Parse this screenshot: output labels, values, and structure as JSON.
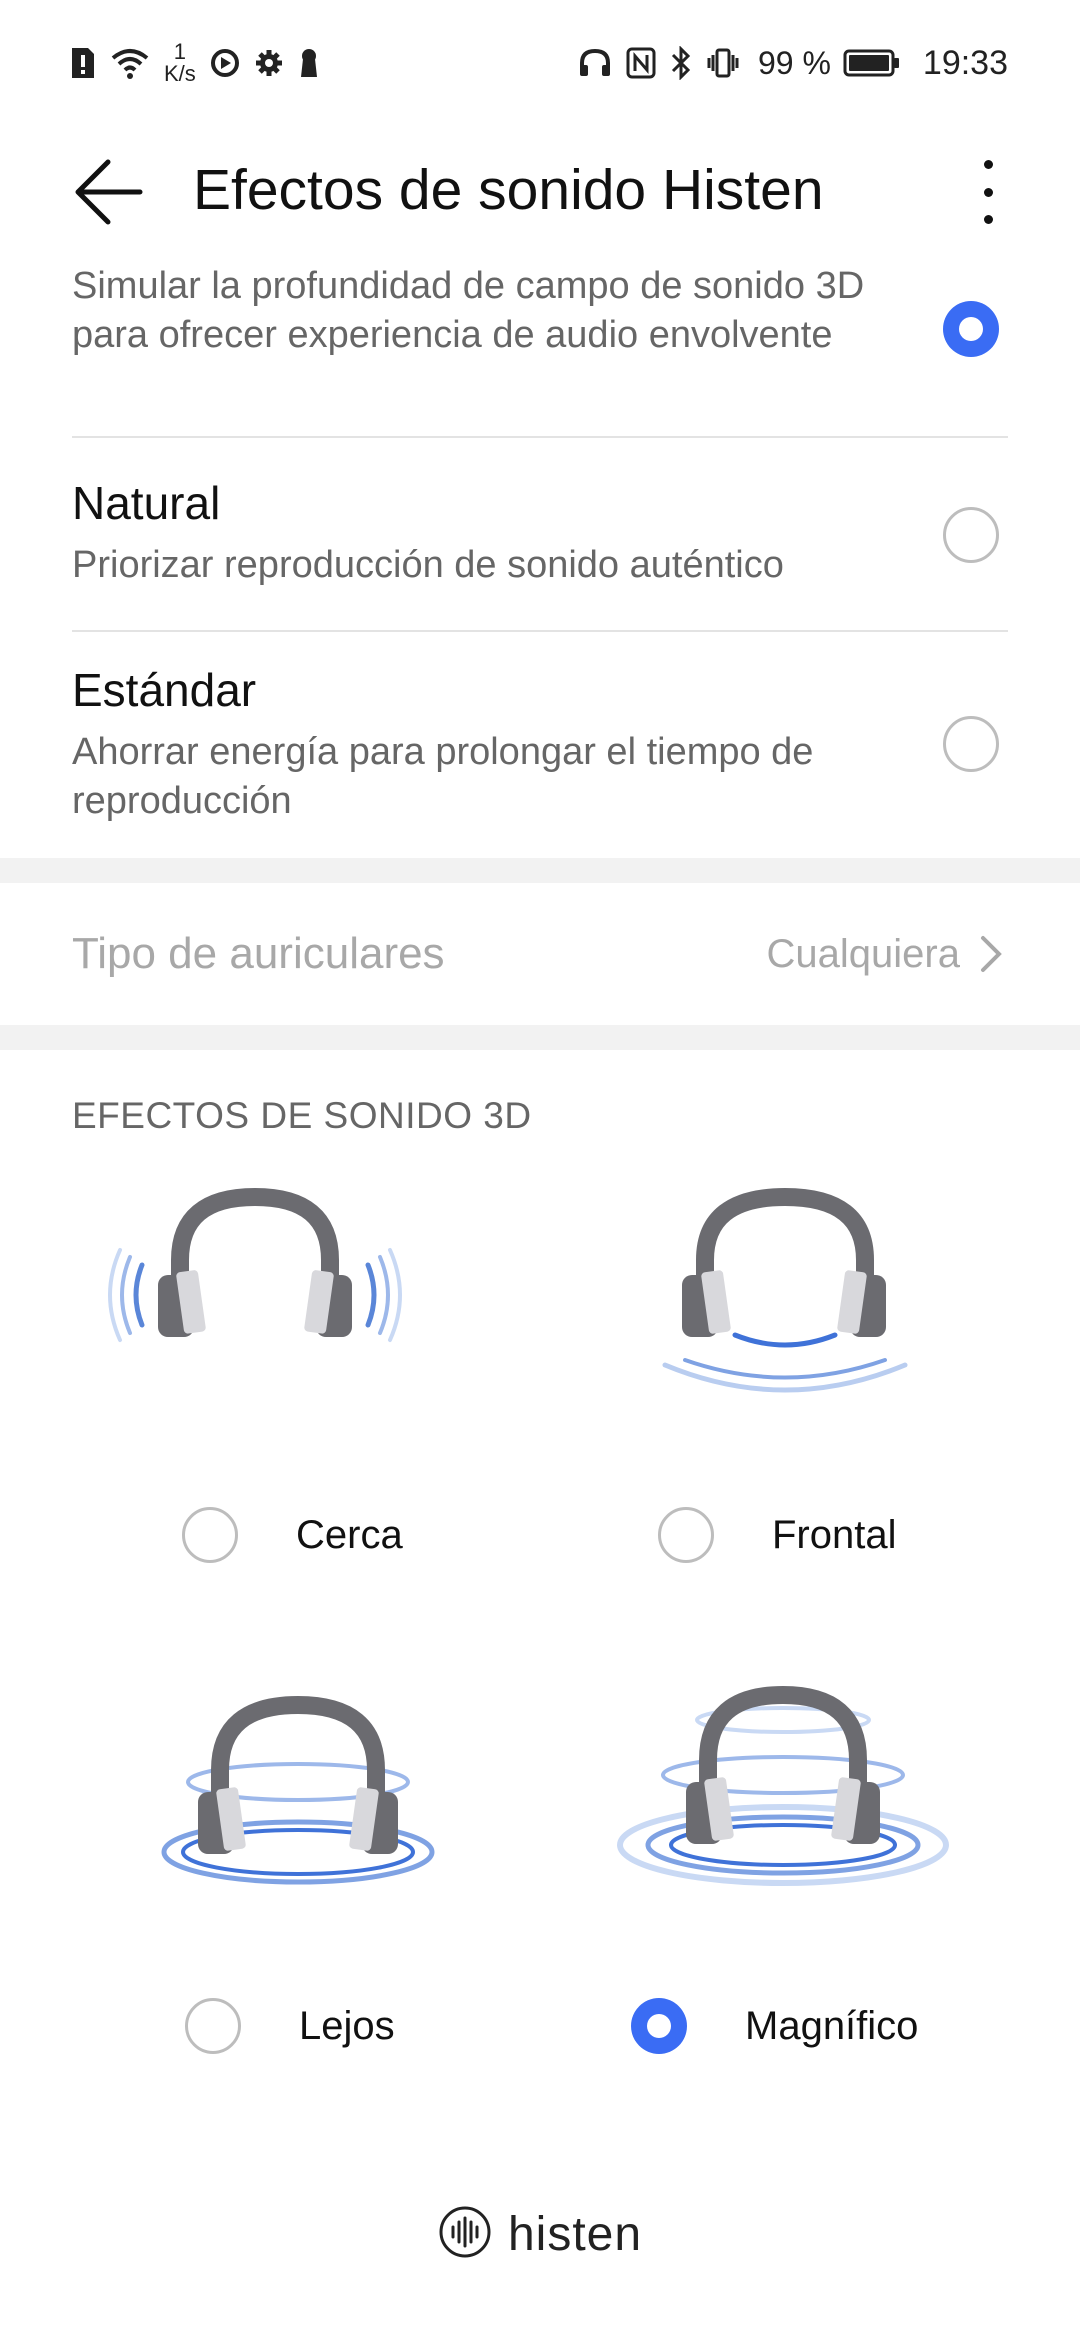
{
  "status_bar": {
    "speed_value": "1",
    "speed_unit": "K/s",
    "battery_percent": "99 %",
    "time": "19:33",
    "icons_left": [
      "sim-alert-icon",
      "wifi-icon",
      "speed-icon",
      "media-icon",
      "settings-icon",
      "keyhole-icon"
    ],
    "icons_right": [
      "headphones-icon",
      "nfc-icon",
      "bluetooth-icon",
      "vibrate-icon",
      "battery-icon"
    ]
  },
  "header": {
    "title": "Efectos de sonido Histen",
    "back_icon": "arrow-left-icon",
    "more_icon": "more-vertical-icon"
  },
  "modes": [
    {
      "title": "",
      "description": "Simular la profundidad de campo de sonido 3D para ofrecer experiencia de audio envolvente",
      "selected": true
    },
    {
      "title": "Natural",
      "description": "Priorizar reproducción de sonido auténtico",
      "selected": false
    },
    {
      "title": "Estándar",
      "description": "Ahorrar energía para prolongar el tiempo de reproducción",
      "selected": false
    }
  ],
  "earphone_type": {
    "label": "Tipo de auriculares",
    "value": "Cualquiera"
  },
  "effects_section": {
    "heading": "EFECTOS DE SONIDO 3D",
    "items": [
      {
        "label": "Cerca",
        "selected": false,
        "icon": "headphones-near-icon"
      },
      {
        "label": "Frontal",
        "selected": false,
        "icon": "headphones-front-icon"
      },
      {
        "label": "Lejos",
        "selected": false,
        "icon": "headphones-far-icon"
      },
      {
        "label": "Magnífico",
        "selected": true,
        "icon": "headphones-grand-icon"
      }
    ]
  },
  "brand": {
    "name": "histen"
  },
  "colors": {
    "accent": "#3a6cf4",
    "wave": "#6f96e0",
    "headphone": "#6b6b70"
  }
}
